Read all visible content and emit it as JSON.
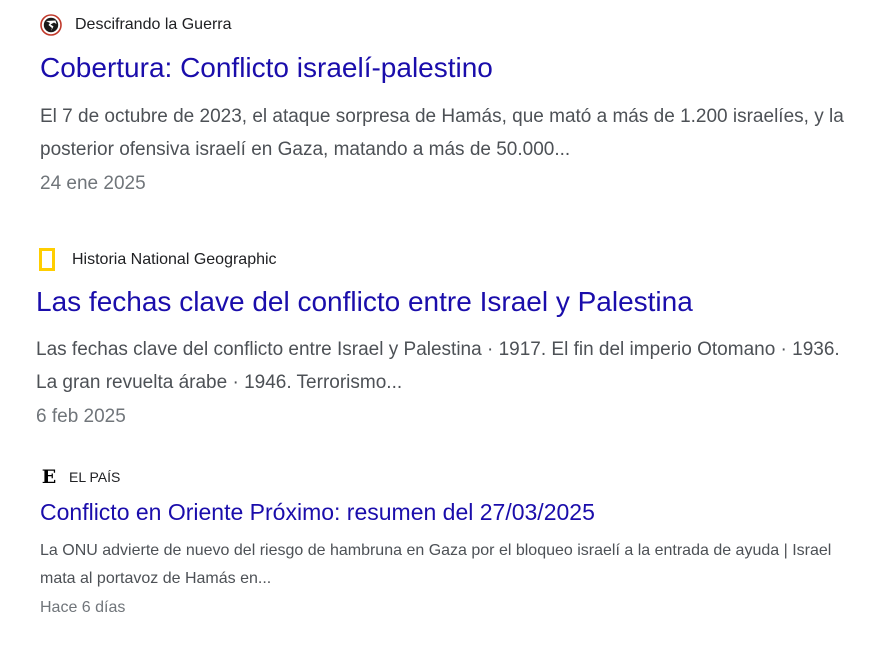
{
  "results": [
    {
      "source": "Descifrando la Guerra",
      "favicon": "globe-arrow-icon",
      "title": "Cobertura: Conflicto israelí-palestino",
      "snippet": "El 7 de octubre de 2023, el ataque sorpresa de Hamás, que mató a más de 1.200 israelíes, y la posterior ofensiva israelí en Gaza, matando a más de 50.000...",
      "date": "24 ene 2025"
    },
    {
      "source": "Historia National Geographic",
      "favicon": "yellow-frame-icon",
      "title": "Las fechas clave del conflicto entre Israel y Palestina",
      "snippet": "Las fechas clave del conflicto entre Israel y Palestina · 1917. El fin del imperio Otomano · 1936. La gran revuelta árabe · 1946. Terrorismo...",
      "date": "6 feb 2025"
    },
    {
      "source": "EL PAÍS",
      "favicon": "elpais-e-icon",
      "favicon_letter": "E",
      "title": "Conflicto en Oriente Próximo: resumen del 27/03/2025",
      "snippet": "La ONU advierte de nuevo del riesgo de hambruna en Gaza por el bloqueo israelí a la entrada de ayuda | Israel mata al portavoz de Hamás en...",
      "date": "Hace 6 días"
    }
  ],
  "colors": {
    "title_link": "#1a0dab",
    "snippet_text": "#4d5156",
    "date_text": "#70757a",
    "natgeo_yellow": "#ffce00",
    "favicon_red": "#c0392b"
  }
}
